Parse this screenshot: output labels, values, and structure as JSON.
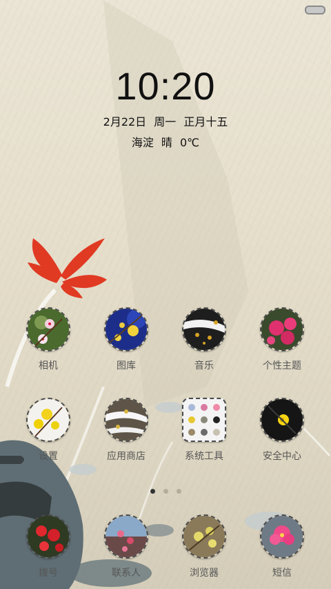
{
  "lockscreen": {
    "time": "10:20",
    "date": "2月22日  周一  正月十五",
    "weather": "海淀  晴  0℃"
  },
  "apps_row1": [
    {
      "label": "相机",
      "icon": "camera-icon"
    },
    {
      "label": "图库",
      "icon": "gallery-icon"
    },
    {
      "label": "音乐",
      "icon": "music-icon"
    },
    {
      "label": "个性主题",
      "icon": "theme-icon"
    }
  ],
  "apps_row2": [
    {
      "label": "设置",
      "icon": "settings-icon"
    },
    {
      "label": "应用商店",
      "icon": "app-store-icon"
    },
    {
      "label": "系统工具",
      "icon": "system-tools-icon"
    },
    {
      "label": "安全中心",
      "icon": "security-center-icon"
    }
  ],
  "dock": [
    {
      "label": "拨号",
      "icon": "dialer-icon"
    },
    {
      "label": "联系人",
      "icon": "contacts-icon"
    },
    {
      "label": "浏览器",
      "icon": "browser-icon"
    },
    {
      "label": "短信",
      "icon": "messages-icon"
    }
  ],
  "pager": {
    "pages": 3,
    "current": 1
  },
  "colors": {
    "accent_flower": "#e03a23",
    "ink": "#5f6e74",
    "text": "#111111",
    "label": "#555555"
  }
}
